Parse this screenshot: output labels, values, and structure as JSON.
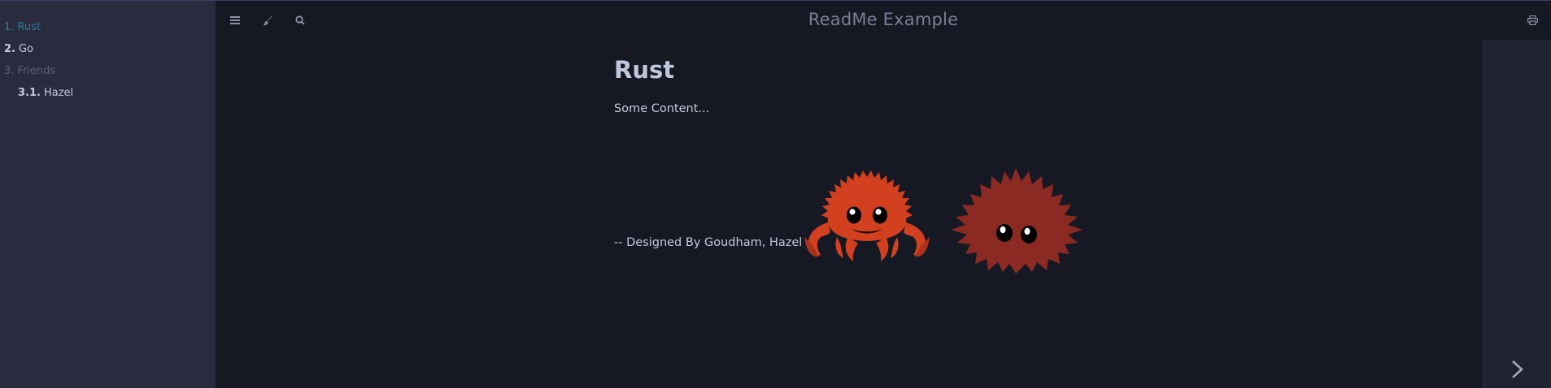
{
  "app": {
    "title": "ReadMe Example"
  },
  "menubar": {
    "icons": [
      "hamburger-icon",
      "paintbrush-icon",
      "search-icon",
      "print-icon"
    ]
  },
  "sidebar": {
    "items": [
      {
        "number": "1.",
        "label": "Rust",
        "state": "active"
      },
      {
        "number": "2.",
        "label": "Go",
        "state": "normal"
      },
      {
        "number": "3.",
        "label": "Friends",
        "state": "draft"
      },
      {
        "number": "3.1.",
        "label": "Hazel",
        "state": "normal"
      }
    ]
  },
  "page": {
    "heading": "Rust",
    "body": "Some Content...",
    "credit": "-- Designed By Goudham, Hazel --"
  },
  "nav": {
    "next_icon": "chevron-right-icon"
  },
  "colors": {
    "sidebar_bg": "#292c3f",
    "main_bg": "#161923",
    "active_link": "#2b79a2",
    "ferris_orange": "#d2401f",
    "hazel_red": "#8b2a22"
  }
}
